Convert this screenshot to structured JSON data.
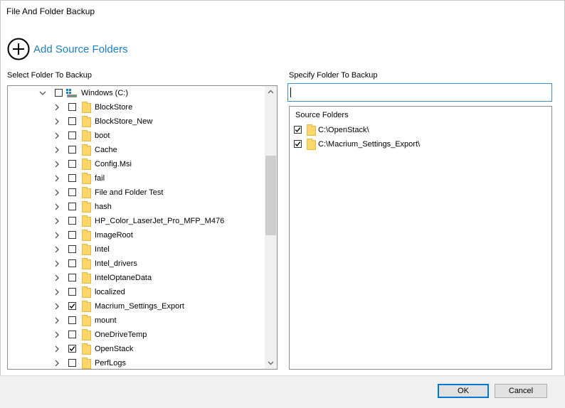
{
  "window": {
    "title": "File And Folder Backup"
  },
  "add_source": {
    "label": "Add Source Folders",
    "icon": "plus-circle-icon"
  },
  "left_panel": {
    "label": "Select Folder To Backup",
    "root": {
      "label": "Windows (C:)",
      "checked": false,
      "expanded": true
    },
    "items": [
      {
        "label": "BlockStore",
        "checked": false
      },
      {
        "label": "BlockStore_New",
        "checked": false
      },
      {
        "label": "boot",
        "checked": false
      },
      {
        "label": "Cache",
        "checked": false
      },
      {
        "label": "Config.Msi",
        "checked": false
      },
      {
        "label": "fail",
        "checked": false
      },
      {
        "label": "File and Folder Test",
        "checked": false
      },
      {
        "label": "hash",
        "checked": false
      },
      {
        "label": "HP_Color_LaserJet_Pro_MFP_M476",
        "checked": false
      },
      {
        "label": "ImageRoot",
        "checked": false
      },
      {
        "label": "Intel",
        "checked": false
      },
      {
        "label": "Intel_drivers",
        "checked": false
      },
      {
        "label": "IntelOptaneData",
        "checked": false
      },
      {
        "label": "localized",
        "checked": false
      },
      {
        "label": "Macrium_Settings_Export",
        "checked": true
      },
      {
        "label": "mount",
        "checked": false
      },
      {
        "label": "OneDriveTemp",
        "checked": false
      },
      {
        "label": "OpenStack",
        "checked": true
      },
      {
        "label": "PerfLogs",
        "checked": false
      }
    ]
  },
  "right_panel": {
    "label": "Specify Folder To Backup",
    "input_value": "",
    "source_title": "Source Folders",
    "sources": [
      {
        "label": "C:\\OpenStack\\",
        "checked": true
      },
      {
        "label": "C:\\Macrium_Settings_Export\\",
        "checked": true
      }
    ]
  },
  "buttons": {
    "ok": "OK",
    "cancel": "Cancel"
  },
  "colors": {
    "accent": "#1a7fc9",
    "focus_border": "#0078d7",
    "folder": "#fbd66a"
  }
}
